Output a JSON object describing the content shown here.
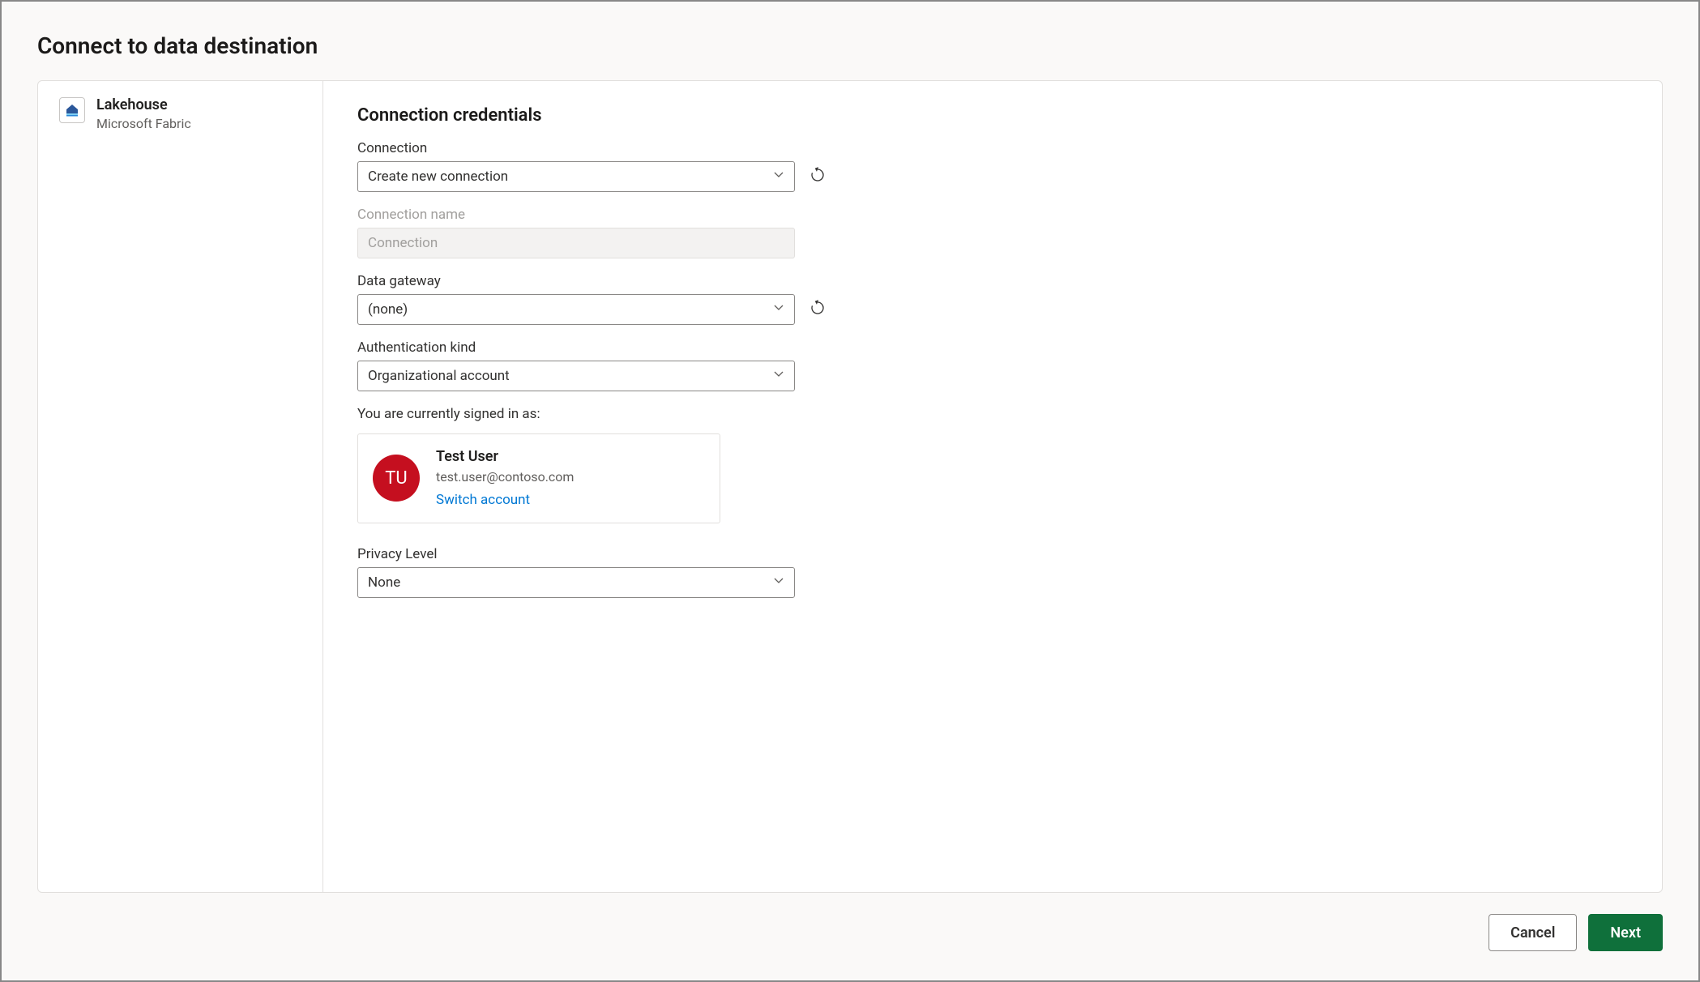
{
  "dialog": {
    "title": "Connect to data destination"
  },
  "sidebar": {
    "item": {
      "label": "Lakehouse",
      "sublabel": "Microsoft Fabric"
    }
  },
  "main": {
    "section_title": "Connection credentials",
    "connection": {
      "label": "Connection",
      "value": "Create new connection"
    },
    "connection_name": {
      "label": "Connection name",
      "placeholder": "Connection"
    },
    "data_gateway": {
      "label": "Data gateway",
      "value": "(none)"
    },
    "auth_kind": {
      "label": "Authentication kind",
      "value": "Organizational account"
    },
    "signed_in_label": "You are currently signed in as:",
    "user": {
      "initials": "TU",
      "name": "Test User",
      "email": "test.user@contoso.com",
      "switch_label": "Switch account"
    },
    "privacy": {
      "label": "Privacy Level",
      "value": "None"
    }
  },
  "footer": {
    "cancel": "Cancel",
    "next": "Next"
  }
}
